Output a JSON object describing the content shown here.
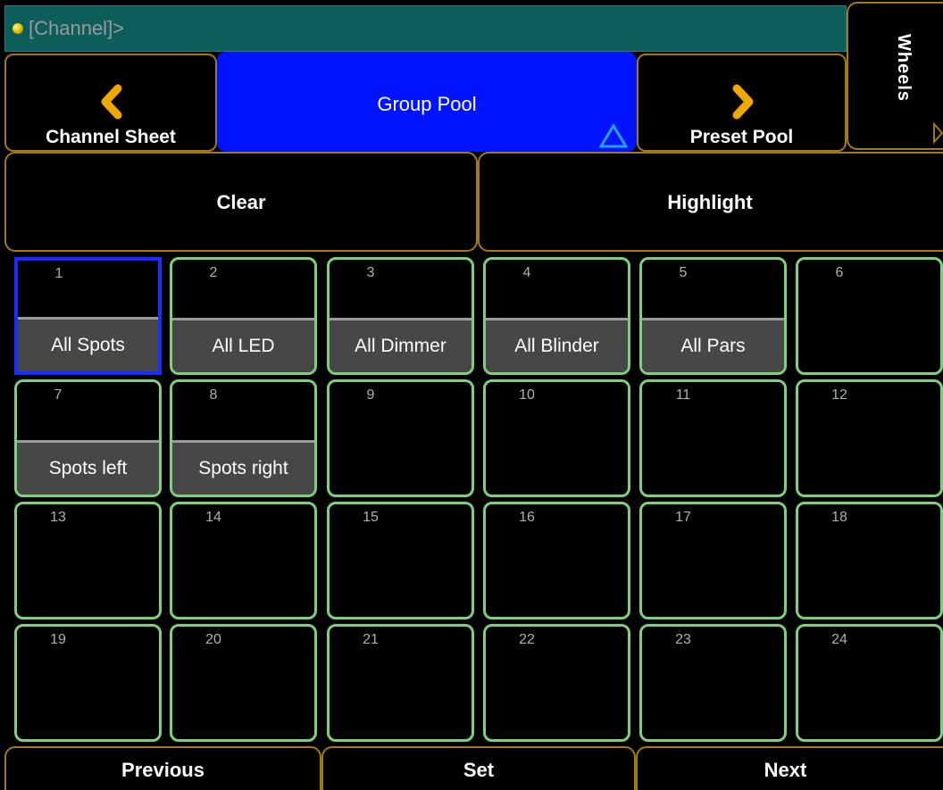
{
  "command_line": {
    "text": "[Channel]>"
  },
  "nav": {
    "prev_label": "Channel Sheet",
    "current_label": "Group Pool",
    "next_label": "Preset Pool",
    "side_label": "Wheels"
  },
  "actions": {
    "clear_label": "Clear",
    "highlight_label": "Highlight"
  },
  "groups": [
    {
      "num": "1",
      "name": "All Spots"
    },
    {
      "num": "2",
      "name": "All LED"
    },
    {
      "num": "3",
      "name": "All Dimmer"
    },
    {
      "num": "4",
      "name": "All Blinder"
    },
    {
      "num": "5",
      "name": "All Pars"
    },
    {
      "num": "6",
      "name": ""
    },
    {
      "num": "7",
      "name": "Spots left"
    },
    {
      "num": "8",
      "name": "Spots right"
    },
    {
      "num": "9",
      "name": ""
    },
    {
      "num": "10",
      "name": ""
    },
    {
      "num": "11",
      "name": ""
    },
    {
      "num": "12",
      "name": ""
    },
    {
      "num": "13",
      "name": ""
    },
    {
      "num": "14",
      "name": ""
    },
    {
      "num": "15",
      "name": ""
    },
    {
      "num": "16",
      "name": ""
    },
    {
      "num": "17",
      "name": ""
    },
    {
      "num": "18",
      "name": ""
    },
    {
      "num": "19",
      "name": ""
    },
    {
      "num": "20",
      "name": ""
    },
    {
      "num": "21",
      "name": ""
    },
    {
      "num": "22",
      "name": ""
    },
    {
      "num": "23",
      "name": ""
    },
    {
      "num": "24",
      "name": ""
    }
  ],
  "selected_group": "1",
  "footer": {
    "previous_label": "Previous",
    "set_label": "Set",
    "next_label": "Next"
  },
  "colors": {
    "command_line_bg": "#0d5e5a",
    "active_tab": "#0014ff",
    "frame_gold": "#a07a12",
    "cell_border_green": "#7ed07e",
    "selected_border": "#1a2cff",
    "chevron": "#f0a800"
  },
  "icons": {
    "status": "status-dot-icon",
    "prev": "chevron-left-icon",
    "next": "chevron-right-icon",
    "active_marker": "triangle-outline-icon",
    "side_marker": "triangle-right-icon"
  }
}
